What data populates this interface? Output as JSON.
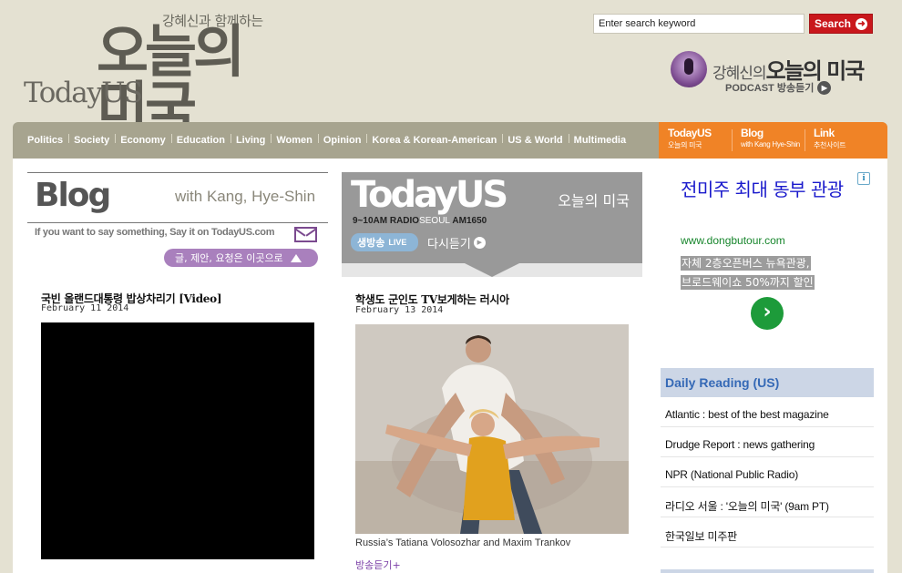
{
  "header": {
    "logo_sub": "강혜신과 함께하는",
    "logo_main": "오늘의 미국",
    "logo_en": "TodayUS",
    "search_placeholder": "Enter search keyword",
    "search_button": "Search",
    "podcast_title_prefix": "강혜신의",
    "podcast_title_main": "오늘의 미국",
    "podcast_sub": "PODCAST 방송듣기"
  },
  "nav": {
    "items": [
      "Politics",
      "Society",
      "Economy",
      "Education",
      "Living",
      "Women",
      "Opinion",
      "Korea & Korean-American",
      "US & World",
      "Multimedia"
    ],
    "special": [
      {
        "title": "TodayUS",
        "sub": "오늘의 미국"
      },
      {
        "title": "Blog",
        "sub": "with Kang Hye-Shin"
      },
      {
        "title": "Link",
        "sub": "추천사이트"
      }
    ]
  },
  "blog": {
    "title": "Blog",
    "with": "with Kang, Hye-Shin",
    "say": "If you want to say something, Say it on TodayUS.com",
    "button": "글, 제안, 요청은 이곳으로",
    "post_title": "국빈 올랜드대통령 밥상차리기 [Video]",
    "post_date": "February 11 2014"
  },
  "today": {
    "logo": "TodayUS",
    "kr": "오늘의 미국",
    "time": "9~10AM",
    "radio": "RADIO",
    "seoul": "SEOUL",
    "am": "AM1650",
    "live_kr": "생방송",
    "live_en": "LIVE",
    "replay": "다시듣기",
    "post_title": "학생도 군인도 TV보게하는 러시아",
    "post_date": "February 13 2014",
    "caption": "Russia’s Tatiana Volosozhar and Maxim Trankov",
    "listen": "방송듣기+"
  },
  "ad": {
    "info": "i",
    "title": "전미주 최대 동부 관광",
    "url": "www.dongbutour.com",
    "desc_lines": [
      "자체 2층오픈버스 뉴욕관광,",
      "브로드웨이쇼 50%까지 할인"
    ]
  },
  "daily": {
    "heading": "Daily Reading (US)",
    "items": [
      "Atlantic : best of the best magazine",
      "Drudge Report : news gathering",
      "NPR (National Public Radio)",
      "라디오 서울 : '오늘의 미국' (9am PT)",
      "한국일보 미주판"
    ]
  },
  "colors": {
    "nav_bg": "#a7a48f",
    "nav_orange": "#f08326",
    "search_red": "#c9171c",
    "purple": "#7b4a8f",
    "daily_head_bg": "#ccd6e6",
    "daily_head_text": "#3569b6"
  }
}
